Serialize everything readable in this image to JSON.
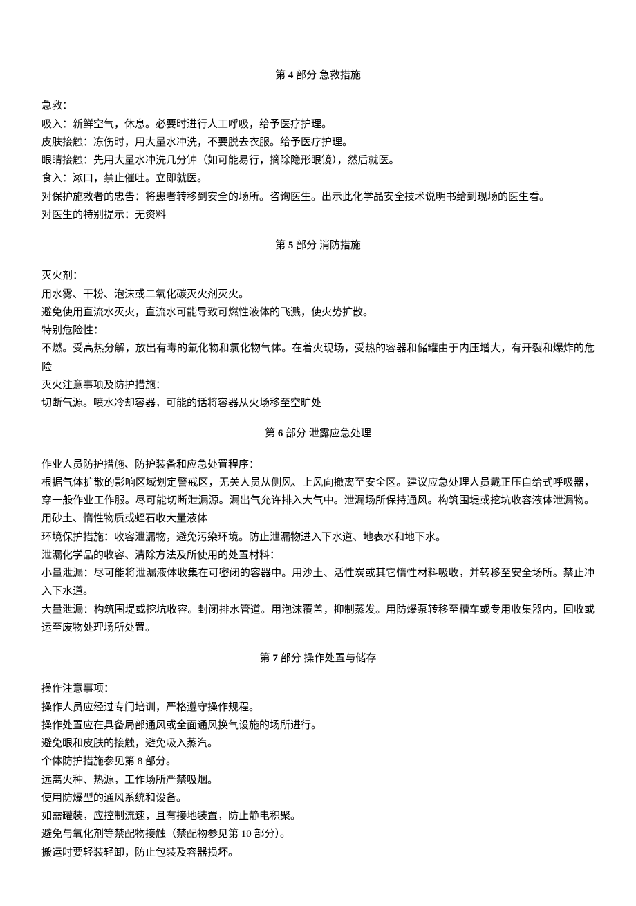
{
  "section4": {
    "title_pre": "第 ",
    "title_num": "4",
    "title_post": " 部分 急救措施",
    "p1": "急救：",
    "p2": "吸入：新鲜空气，休息。必要时进行人工呼吸，给予医疗护理。",
    "p3": "皮肤接触：冻伤时，用大量水冲洗，不要脱去衣服。给予医疗护理。",
    "p4": "眼睛接触：先用大量水冲洗几分钟（如可能易行，摘除隐形眼镜），然后就医。",
    "p5": "食入：漱口，禁止催吐。立即就医。",
    "p6": "对保护施救者的忠告：将患者转移到安全的场所。咨询医生。出示此化学品安全技术说明书给到现场的医生看。",
    "p7": "对医生的特别提示：无资料"
  },
  "section5": {
    "title_pre": "第 ",
    "title_num": "5",
    "title_post": " 部分 消防措施",
    "p1": "灭火剂：",
    "p2": "用水雾、干粉、泡沫或二氧化碳灭火剂灭火。",
    "p3": "避免使用直流水灭火，直流水可能导致可燃性液体的飞溅，使火势扩散。",
    "p4": "特别危险性：",
    "p5": "不燃。受高热分解，放出有毒的氟化物和氯化物气体。在着火现场，受热的容器和储罐由于内压增大，有开裂和爆炸的危险",
    "p6": "灭火注意事项及防护措施：",
    "p7": "切断气源。喷水冷却容器，可能的话将容器从火场移至空旷处"
  },
  "section6": {
    "title_pre": "第 ",
    "title_num": "6",
    "title_post": " 部分 泄露应急处理",
    "p1": "作业人员防护措施、防护装备和应急处置程序：",
    "p2": "根据气体扩散的影响区域划定警戒区，无关人员从侧风、上风向撤离至安全区。建议应急处理人员戴正压自给式呼吸器，穿一般作业工作服。尽可能切断泄漏源。漏出气允许排入大气中。泄漏场所保持通风。构筑围堤或挖坑收容液体泄漏物。用砂土、惰性物质或蛭石收大量液体",
    "p3": "环境保护措施：收容泄漏物，避免污染环境。防止泄漏物进入下水道、地表水和地下水。",
    "p4": "泄漏化学品的收容、清除方法及所使用的处置材料：",
    "p5": "小量泄漏：尽可能将泄漏液体收集在可密闭的容器中。用沙土、活性炭或其它惰性材料吸收，并转移至安全场所。禁止冲入下水道。",
    "p6": "大量泄漏：构筑围堤或挖坑收容。封闭排水管道。用泡沫覆盖，抑制蒸发。用防爆泵转移至槽车或专用收集器内，回收或运至废物处理场所处置。"
  },
  "section7": {
    "title_pre": "第 ",
    "title_num": "7",
    "title_post": " 部分 操作处置与储存",
    "p1": "操作注意事项：",
    "p2": "操作人员应经过专门培训，严格遵守操作规程。",
    "p3": "操作处置应在具备局部通风或全面通风换气设施的场所进行。",
    "p4": "避免眼和皮肤的接触，避免吸入蒸汽。",
    "p5": "个体防护措施参见第 8 部分。",
    "p6": "远离火种、热源，工作场所严禁吸烟。",
    "p7": "使用防爆型的通风系统和设备。",
    "p8": "如需罐装，应控制流速，且有接地装置，防止静电积聚。",
    "p9": "避免与氧化剂等禁配物接触（禁配物参见第 10 部分）。",
    "p10": "搬运时要轻装轻卸，防止包装及容器损坏。"
  }
}
